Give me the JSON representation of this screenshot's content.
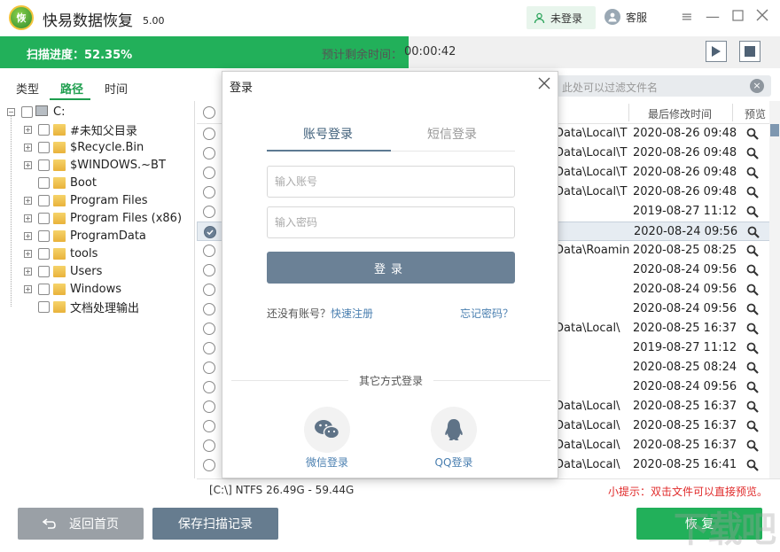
{
  "app": {
    "logo_text": "恢",
    "title": "快易数据恢复",
    "version": "5.00"
  },
  "topbar": {
    "login_label": "未登录",
    "service_label": "客服"
  },
  "progress": {
    "label": "扫描进度：52.35%",
    "fraction": 0.5235,
    "eta_label": "预计剩余时间：",
    "eta_value": "00:00:42"
  },
  "tabs": [
    {
      "label": "类型"
    },
    {
      "label": "路径"
    },
    {
      "label": "时间"
    }
  ],
  "tree": {
    "root": "C:",
    "items": [
      "#未知父目录",
      "$Recycle.Bin",
      "$WINDOWS.~BT",
      "Boot",
      "Program Files",
      "Program Files (x86)",
      "ProgramData",
      "tools",
      "Users",
      "Windows",
      "文档处理输出"
    ]
  },
  "search": {
    "placeholder": "此处可以过滤文件名"
  },
  "table": {
    "headers": {
      "modified": "最后修改时间",
      "preview": "预览"
    },
    "rows": [
      {
        "path": "Data\\Local\\T",
        "date": "2020-08-26  09:48",
        "checked": false
      },
      {
        "path": "Data\\Local\\T",
        "date": "2020-08-26  09:48",
        "checked": false
      },
      {
        "path": "Data\\Local\\T",
        "date": "2020-08-26  09:48",
        "checked": false
      },
      {
        "path": "Data\\Local\\T",
        "date": "2020-08-26  09:48",
        "checked": false
      },
      {
        "path": "",
        "date": "2019-08-27  11:12",
        "checked": false
      },
      {
        "path": "",
        "date": "2020-08-24  09:56",
        "checked": true
      },
      {
        "path": "Data\\Roamin",
        "date": "2020-08-25  08:25",
        "checked": false
      },
      {
        "path": "",
        "date": "2020-08-24  09:56",
        "checked": false
      },
      {
        "path": "",
        "date": "2020-08-24  09:56",
        "checked": false
      },
      {
        "path": "",
        "date": "2020-08-24  09:56",
        "checked": false
      },
      {
        "path": "Data\\Local\\",
        "date": "2020-08-25  16:37",
        "checked": false
      },
      {
        "path": "",
        "date": "2019-08-27  11:12",
        "checked": false
      },
      {
        "path": "",
        "date": "2020-08-25  08:24",
        "checked": false
      },
      {
        "path": "",
        "date": "2020-08-24  09:56",
        "checked": false
      },
      {
        "path": "Data\\Local\\",
        "date": "2020-08-25  16:37",
        "checked": false
      },
      {
        "path": "Data\\Local\\",
        "date": "2020-08-25  16:37",
        "checked": false
      },
      {
        "path": "Data\\Local\\",
        "date": "2020-08-25  16:37",
        "checked": false
      },
      {
        "path": "Data\\Local\\",
        "date": "2020-08-25  16:41",
        "checked": false
      }
    ]
  },
  "status": {
    "drive_info": "[C:\\] NTFS 26.49G - 59.44G",
    "tip": "小提示：双击文件可以直接预览。"
  },
  "buttons": {
    "home": "返回首页",
    "save": "保存扫描记录",
    "recover": "恢 复"
  },
  "login_modal": {
    "title": "登录",
    "tab_account": "账号登录",
    "tab_sms": "短信登录",
    "account_placeholder": "输入账号",
    "password_placeholder": "输入密码",
    "submit": "登录",
    "no_account": "还没有账号？",
    "register": "快速注册",
    "forgot": "忘记密码？",
    "other_methods": "其它方式登录",
    "wechat": "微信登录",
    "qq": "QQ登录"
  },
  "colors": {
    "accent_green": "#22b05a",
    "slate": "#6b8196",
    "tip_red": "#e02a2a"
  }
}
